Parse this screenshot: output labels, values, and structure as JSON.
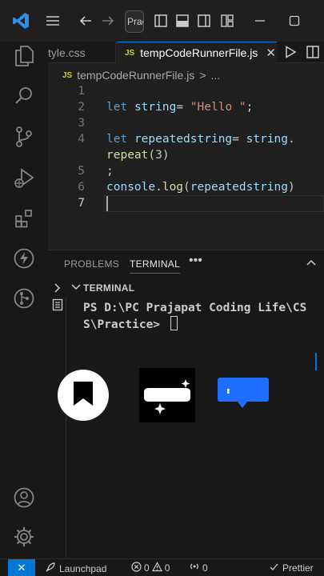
{
  "titlebar": {
    "search_text": "Prac",
    "icons": [
      "vscode-logo-icon",
      "hamburger-menu-icon",
      "arrow-left-icon",
      "arrow-right-icon",
      "layout-sidebar-icon",
      "layout-panel-icon",
      "layout-sidebar-right-icon",
      "customize-layout-icon",
      "minimize-icon",
      "maximize-icon"
    ]
  },
  "activity_bar": {
    "items": [
      "explorer-icon",
      "search-icon",
      "source-control-icon",
      "run-debug-icon",
      "extensions-icon",
      "thunder-client-icon",
      "git-graph-icon"
    ],
    "bottom": [
      "accounts-icon",
      "settings-gear-icon"
    ]
  },
  "tabs": [
    {
      "label": "style.css",
      "visible_label": "tyle.css",
      "active": false
    },
    {
      "label": "tempCodeRunnerFile.js",
      "badge": "JS",
      "active": true
    }
  ],
  "breadcrumb": {
    "badge": "JS",
    "file": "tempCodeRunnerFile.js",
    "separator": ">",
    "more": "..."
  },
  "editor": {
    "line_numbers": [
      "1",
      "2",
      "3",
      "4",
      "",
      "5",
      "6",
      "7"
    ],
    "lines": {
      "l2_kw": "let",
      "l2_var": "string",
      "l2_op": "= ",
      "l2_str": "\"Hello \"",
      "l2_end": ";",
      "l4_kw": "let",
      "l4_var": "repeatedstring",
      "l4_op": "= ",
      "l4_obj": "string",
      "l4_dot": ".",
      "l4b_fn": "repeat",
      "l4b_open": "(",
      "l4b_num": "3",
      "l4b_close": ")",
      "l5_semi": ";",
      "l6_obj": "console",
      "l6_dot": ".",
      "l6_fn": "log",
      "l6_open": "(",
      "l6_arg": "repeatedstring",
      "l6_close": ")"
    }
  },
  "panel": {
    "tabs": [
      "PROBLEMS",
      "TERMINAL"
    ],
    "more": "•••",
    "section_title": "TERMINAL",
    "terminal_lines": [
      "PS D:\\PC Prajapat Coding Life\\CS",
      "S\\Practice> "
    ]
  },
  "status_bar": {
    "launchpad": "Launchpad",
    "errors": "0",
    "warnings": "0",
    "ports": "0",
    "prettier": "Prettier"
  },
  "colors": {
    "accent": "#0078d4",
    "keyword": "#569cd6",
    "variable": "#9cdcfe",
    "string": "#ce9178",
    "number": "#b5cea8",
    "function": "#dcdcaa",
    "js_badge": "#cbcb41",
    "comment_button": "#1f6fff"
  }
}
